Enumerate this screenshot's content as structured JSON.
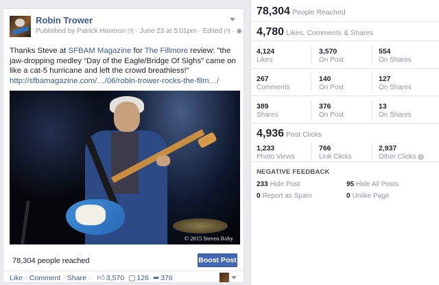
{
  "post": {
    "page_name": "Robin Trower",
    "published_by": "Published by Patrick Haveron",
    "help_mark": "[?]",
    "date": "June 23 at 5:01pm",
    "edited": "Edited",
    "text_before_link1": "Thanks Steve at ",
    "link1": "SFBAM Magazine",
    "text_between": " for ",
    "link2": "The Fillmore",
    "text_after": " review: \"the jaw-dropping medley “Day of the Eagle/Bridge Of Sighs” came on like a cat-5 hurricane and left the crowd breathless!\"",
    "url": "http://sfbamagazine.com/…/06/robin-trower-rocks-the-film…/",
    "photo_credit": "© 2015 Steven Roby",
    "people_reached": "78,304 people reached",
    "boost_label": "Boost Post",
    "actions": {
      "like": "Like",
      "comment": "Comment",
      "share": "Share"
    },
    "counts": {
      "likes": "3,570",
      "comments": "126",
      "shares": "376"
    }
  },
  "insights": {
    "reached": {
      "value": "78,304",
      "label": "People Reached"
    },
    "engagement": {
      "value": "4,780",
      "label": "Likes, Comments & Shares"
    },
    "grid": [
      [
        {
          "v": "4,124",
          "l": "Likes"
        },
        {
          "v": "3,570",
          "l": "On Post"
        },
        {
          "v": "554",
          "l": "On Shares"
        }
      ],
      [
        {
          "v": "267",
          "l": "Comments"
        },
        {
          "v": "140",
          "l": "On Post"
        },
        {
          "v": "127",
          "l": "On Shares"
        }
      ],
      [
        {
          "v": "389",
          "l": "Shares"
        },
        {
          "v": "376",
          "l": "On Post"
        },
        {
          "v": "13",
          "l": "On Shares"
        }
      ]
    ],
    "post_clicks": {
      "value": "4,936",
      "label": "Post Clicks"
    },
    "clicks": [
      {
        "v": "1,233",
        "l": "Photo Views"
      },
      {
        "v": "766",
        "l": "Link Clicks"
      },
      {
        "v": "2,937",
        "l": "Other Clicks"
      }
    ],
    "info_mark": "i",
    "negative_title": "NEGATIVE FEEDBACK",
    "negative": [
      {
        "v": "233",
        "l": "Hide Post"
      },
      {
        "v": "95",
        "l": "Hide All Posts"
      },
      {
        "v": "0",
        "l": "Report as Spam"
      },
      {
        "v": "0",
        "l": "Unlike Page"
      }
    ]
  }
}
